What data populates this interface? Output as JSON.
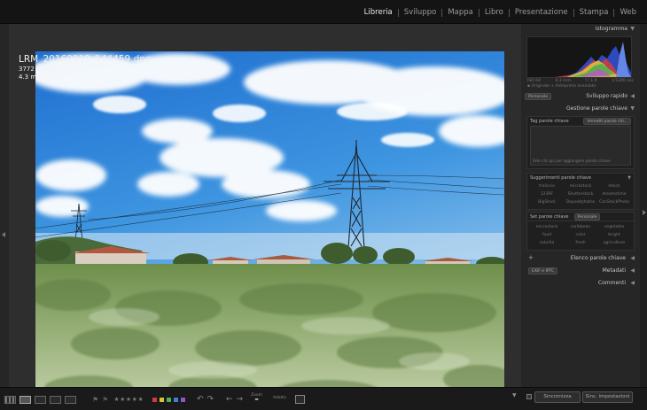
{
  "modules": [
    "Libreria",
    "Sviluppo",
    "Mappa",
    "Libro",
    "Presentazione",
    "Stampa",
    "Web"
  ],
  "active_module": "Libreria",
  "photo_info": {
    "filename": "LRM_20160919_144459.dng",
    "dimensions": "3772 x 2819",
    "focal": "4.3 mm"
  },
  "right_panel": {
    "histogram": {
      "title": "Istogramma",
      "meta": [
        "ISO 64",
        "4.3 mm",
        "f / 1.9",
        "1/1300 sec"
      ],
      "option": "Originale + Anteprima avanzata"
    },
    "quick_develop": {
      "preset": "Personale",
      "label": "Sviluppo rapido"
    },
    "keywording": {
      "title": "Gestione parole chiave",
      "tag_label": "Tag parole chiave",
      "tag_select": "Immetti parole chi...",
      "hint": "Fate clic qui per aggiungere parole chiave",
      "suggestions_title": "Suggerimenti parole chiave",
      "suggestions": [
        "traliccio",
        "microstock",
        "Istock",
        "123RF",
        "Shutterstock",
        "dreamstime",
        "BigStock",
        "Depositphotos",
        "CanStockPhoto"
      ],
      "set_title": "Set parole chiave",
      "set_value": "Personale",
      "set_keywords": [
        "microstock",
        "caribbean",
        "vegetable",
        "food",
        "color",
        "bright",
        "colorful",
        "fresh",
        "agriculture"
      ]
    },
    "keyword_list": "Elenco parole chiave",
    "metadata": {
      "preset": "EXIF e IPTC",
      "label": "Metadati"
    },
    "comments": "Commenti"
  },
  "bottom_toolbar": {
    "stars": "★★★★★",
    "zoom_label": "Zoom",
    "zoom_value": "Adatta",
    "sync_button": "Sincronizza",
    "sync_settings_button": "Sinc. impostazioni"
  },
  "colors": {
    "accent": "#e8e8e8",
    "label_red": "#d23c3c",
    "label_yellow": "#d4c23a",
    "label_green": "#4caf50",
    "label_blue": "#3f7fd6",
    "label_purple": "#8a56c9"
  }
}
